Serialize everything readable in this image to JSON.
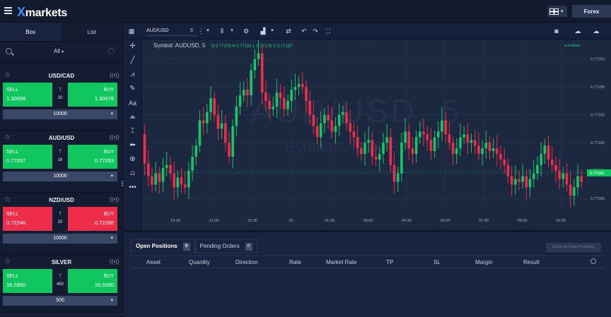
{
  "header": {
    "logo_x": "X",
    "logo_text": "markets",
    "account_button": "Forex"
  },
  "sidebar": {
    "tabs": [
      "Box",
      "List"
    ],
    "filter_label": "All",
    "instruments": [
      {
        "name": "USD/CAD",
        "sell_label": "SELL",
        "sell_price": "1.30658",
        "buy_label": "BUY",
        "buy_price": "1.30678",
        "spread": "20",
        "quantity": "10000",
        "sell_color": "#10c75f",
        "buy_color": "#10c75f"
      },
      {
        "name": "AUD/USD",
        "sell_label": "SELL",
        "sell_price": "0.77037",
        "buy_label": "BUY",
        "buy_price": "0.77053",
        "spread": "16",
        "quantity": "10000",
        "sell_color": "#10c75f",
        "buy_color": "#10c75f"
      },
      {
        "name": "NZD/USD",
        "sell_label": "SELL",
        "sell_price": "0.72246",
        "buy_label": "BUY",
        "buy_price": "0.72266",
        "spread": "20",
        "quantity": "10000",
        "sell_color": "#ee2d4a",
        "buy_color": "#ee2d4a"
      },
      {
        "name": "SILVER",
        "sell_label": "SELL",
        "sell_price": "16.2850",
        "buy_label": "BUY",
        "buy_price": "16.3300",
        "spread": "450",
        "quantity": "500",
        "sell_color": "#10c75f",
        "buy_color": "#10c75f"
      }
    ]
  },
  "chart": {
    "symbol": "AUD/USD",
    "interval": "5",
    "legend_title": "Symbol: AUDUSD, 5",
    "ohlc": "O 0.77179  H 0.77181  L 0.77176  C 0.77187",
    "realtime_label": "realtime",
    "watermark": "AUD/USD, 5",
    "watermark_sub": "Symbol: AUDUSD",
    "current_price": "0.77046",
    "current_price_color": "#10c75f",
    "up_color": "#19c36a",
    "down_color": "#ee2d4a"
  },
  "chart_data": {
    "type": "line",
    "title": "",
    "xlabel": "",
    "ylabel": "",
    "x_ticks": [
      "19:30",
      "21:00",
      "22:30",
      "20",
      "01:30",
      "03:00",
      "04:30",
      "06:00",
      "07:30",
      "09:00",
      "10:05"
    ],
    "y_ticks": [
      "0.77250",
      "0.77200",
      "0.77150",
      "0.77100",
      "0.77050",
      "0.77000"
    ],
    "ylim": [
      0.76975,
      0.77285
    ],
    "series": [
      {
        "values": [
          0.77115,
          0.77063,
          0.7704,
          0.77025,
          0.77045,
          0.7703,
          0.77055,
          0.7706,
          0.77045,
          0.7702,
          0.77038,
          0.77025,
          0.7702,
          0.7705,
          0.77075,
          0.77095,
          0.7714,
          0.77135,
          0.77155,
          0.7718,
          0.7715,
          0.77125,
          0.77135,
          0.771,
          0.77075,
          0.7713,
          0.77165,
          0.77185,
          0.77195,
          0.77185,
          0.7723,
          0.7725,
          0.7726,
          0.7719,
          0.77175,
          0.7716,
          0.77165,
          0.7719,
          0.7718,
          0.7716,
          0.77175,
          0.77195,
          0.772,
          0.77205,
          0.772,
          0.77175,
          0.7715,
          0.7713,
          0.7711,
          0.77135,
          0.7715,
          0.7714,
          0.7712,
          0.7713,
          0.7715,
          0.77155,
          0.77135,
          0.7712,
          0.7711,
          0.7709,
          0.7708,
          0.771,
          0.77105,
          0.77075,
          0.7707,
          0.7708,
          0.771,
          0.7711,
          0.7706,
          0.7703,
          0.77045,
          0.771,
          0.7712,
          0.7709,
          0.7708,
          0.7711,
          0.7712,
          0.77115,
          0.77105,
          0.77085,
          0.7711,
          0.7712,
          0.7714,
          0.77115,
          0.771,
          0.7708,
          0.7709,
          0.7711,
          0.77115,
          0.771,
          0.77105,
          0.77095,
          0.7708,
          0.7709,
          0.771,
          0.77085,
          0.7709,
          0.7708,
          0.7707,
          0.7706,
          0.7704,
          0.77025,
          0.77035,
          0.7703,
          0.7704,
          0.7702,
          0.77035,
          0.77045,
          0.7706,
          0.7708,
          0.77095,
          0.7707,
          0.7706,
          0.7705,
          0.77035,
          0.77045,
          0.77025,
          0.77005,
          0.7702,
          0.7704,
          0.7703
        ]
      }
    ]
  },
  "positions": {
    "tab_open": "Open Positions",
    "tab_open_count": "0",
    "tab_pending": "Pending Orders",
    "tab_pending_count": "0",
    "close_all": "Close all Open Positions",
    "columns": [
      "Asset",
      "Quantity",
      "Direction",
      "Rate",
      "Market Rate",
      "TP",
      "SL",
      "Margin",
      "Result"
    ]
  }
}
